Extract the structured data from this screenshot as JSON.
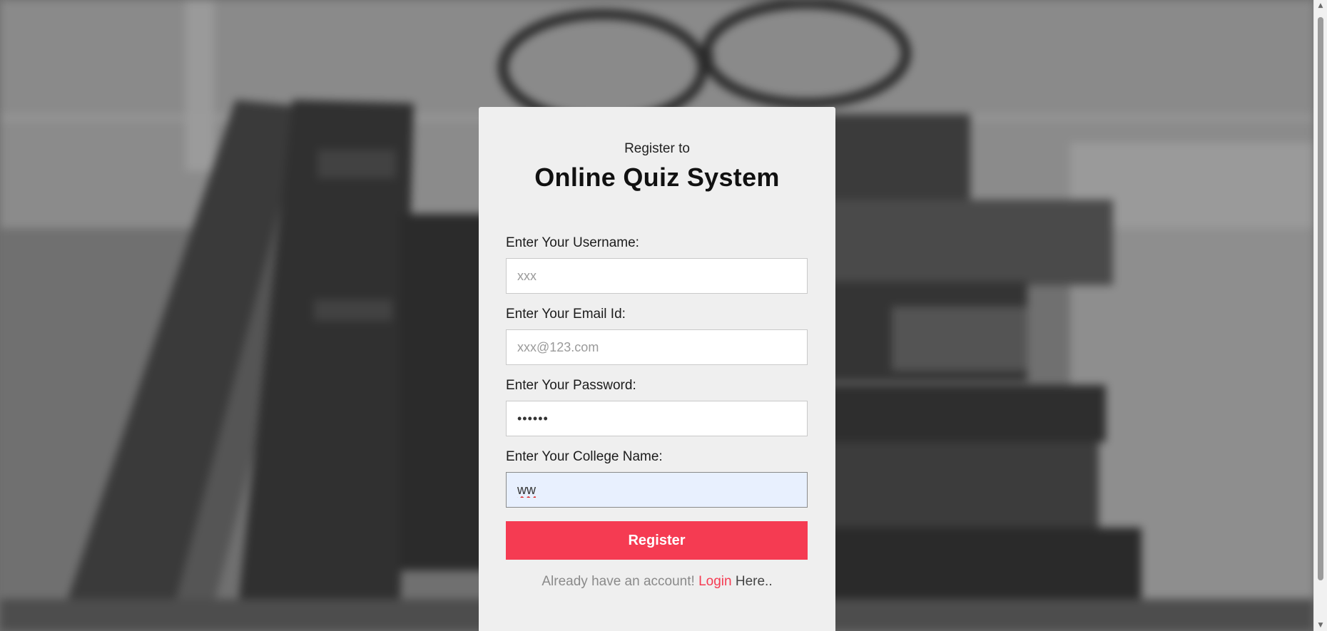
{
  "header": {
    "subtitle": "Register to",
    "title": "Online Quiz System"
  },
  "form": {
    "username": {
      "label": "Enter Your Username:",
      "placeholder": "xxx",
      "value": ""
    },
    "email": {
      "label": "Enter Your Email Id:",
      "placeholder": "xxx@123.com",
      "value": ""
    },
    "password": {
      "label": "Enter Your Password:",
      "placeholder": "",
      "value": "••••••"
    },
    "college": {
      "label": "Enter Your College Name:",
      "placeholder": "",
      "value": "ww"
    },
    "submit_label": "Register"
  },
  "footer": {
    "prefix": "Already have an account!",
    "login_link": "Login",
    "suffix": "Here.."
  },
  "colors": {
    "accent": "#f53b52",
    "card_bg": "#efefef",
    "autofill_bg": "#e8f0fe"
  }
}
